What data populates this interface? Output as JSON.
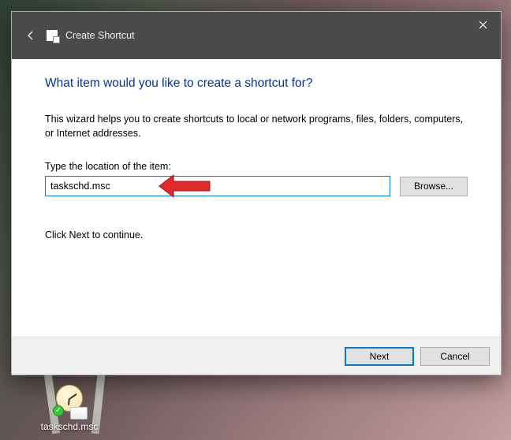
{
  "dialog": {
    "title": "Create Shortcut",
    "heading": "What item would you like to create a shortcut for?",
    "description": "This wizard helps you to create shortcuts to local or network programs, files, folders, computers, or Internet addresses.",
    "field_label": "Type the location of the item:",
    "location_value": "taskschd.msc",
    "browse_label": "Browse...",
    "hint": "Click Next to continue.",
    "next_label": "Next",
    "cancel_label": "Cancel"
  },
  "desktop": {
    "shortcut_name": "taskschd.msc"
  },
  "colors": {
    "accent": "#0078d7",
    "heading": "#003399"
  }
}
